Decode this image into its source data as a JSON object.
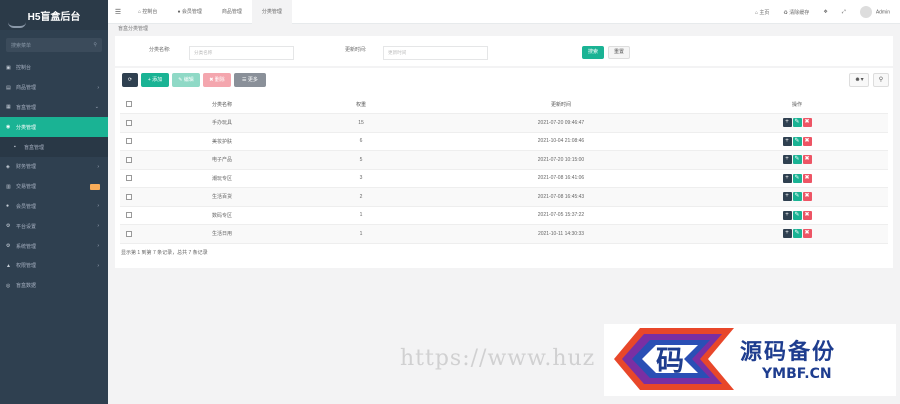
{
  "app": {
    "title": "H5盲盒后台"
  },
  "sidebar": {
    "search_placeholder": "搜索菜单",
    "items": [
      {
        "label": "控制台",
        "icon": "dashboard-icon",
        "state": "normal"
      },
      {
        "label": "商品管理",
        "icon": "goods-icon",
        "state": "collapsed"
      },
      {
        "label": "盲盒管理",
        "icon": "box-icon",
        "state": "expanded"
      },
      {
        "label": "分类管理",
        "icon": "category-icon",
        "state": "active"
      },
      {
        "label": "盲盒管理",
        "icon": "box-sub-icon",
        "state": "sub"
      },
      {
        "label": "财务管理",
        "icon": "finance-icon",
        "state": "collapsed"
      },
      {
        "label": "交易管理",
        "icon": "trade-icon",
        "state": "badge"
      },
      {
        "label": "会员管理",
        "icon": "member-icon",
        "state": "collapsed"
      },
      {
        "label": "平台设置",
        "icon": "platform-icon",
        "state": "collapsed"
      },
      {
        "label": "系统管理",
        "icon": "system-icon",
        "state": "collapsed"
      },
      {
        "label": "权限管理",
        "icon": "permission-icon",
        "state": "collapsed"
      },
      {
        "label": "盲盒数据",
        "icon": "data-icon",
        "state": "normal"
      }
    ]
  },
  "topbar": {
    "tabs": [
      "控制台",
      "会员管理",
      "商品管理",
      "分类管理"
    ],
    "active_tab": 3,
    "right": {
      "home": "主页",
      "clear_cache": "清除缓存",
      "user": "Admin"
    }
  },
  "page": {
    "title": "盲盒分类管理"
  },
  "search": {
    "name_label": "分类名称:",
    "name_placeholder": "分类名称",
    "time_label": "更新时间:",
    "time_placeholder": "更新时间",
    "search_btn": "搜索",
    "reset_btn": "重置"
  },
  "toolbar": {
    "add": "添加",
    "edit": "编辑",
    "delete": "删除",
    "more": "更多"
  },
  "table": {
    "headers": [
      "分类名称",
      "权重",
      "更新时间",
      "操作"
    ],
    "rows": [
      {
        "name": "手办玩具",
        "weight": "15",
        "time": "2021-07-20 09:46:47"
      },
      {
        "name": "美妆护肤",
        "weight": "6",
        "time": "2021-10-04 21:08:46"
      },
      {
        "name": "电子产品",
        "weight": "5",
        "time": "2021-07-20 10:15:00"
      },
      {
        "name": "潮玩专区",
        "weight": "3",
        "time": "2021-07-08 16:41:06"
      },
      {
        "name": "生活百货",
        "weight": "2",
        "time": "2021-07-08 16:45:43"
      },
      {
        "name": "数码专区",
        "weight": "1",
        "time": "2021-07-05 15:37:22"
      },
      {
        "name": "生活日用",
        "weight": "1",
        "time": "2021-10-11 14:30:33"
      }
    ],
    "footer": "显示第 1 到第 7 条记录，总共 7 条记录"
  },
  "watermark": {
    "url": "https://www.huz",
    "mark": "码",
    "name": "源码备份",
    "domain": "YMBF.CN"
  },
  "colors": {
    "accent": "#1ab394",
    "sidebar": "#2f4050",
    "danger": "#ed5565",
    "warning": "#f8ac59"
  }
}
